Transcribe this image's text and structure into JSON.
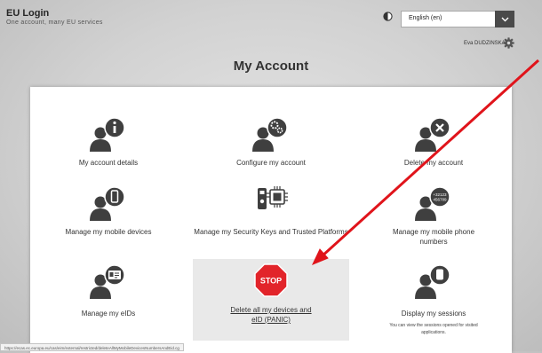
{
  "header": {
    "title": "EU Login",
    "subtitle": "One account, many EU services"
  },
  "language": {
    "selected": "English (en)"
  },
  "user": {
    "name": "Eva DUDZINSKA"
  },
  "page": {
    "title": "My Account"
  },
  "tiles": [
    {
      "label": "My account details",
      "icon": "user-info-icon"
    },
    {
      "label": "Configure my account",
      "icon": "user-gears-icon"
    },
    {
      "label": "Delete my account",
      "icon": "user-delete-icon"
    },
    {
      "label": "Manage my mobile devices",
      "icon": "user-mobile-icon"
    },
    {
      "label": "Manage my Security Keys and Trusted Platforms",
      "icon": "security-key-icon"
    },
    {
      "label": "Manage my mobile phone numbers",
      "icon": "user-phone-number-icon",
      "icon_text_1": "+32123",
      "icon_text_2": "456789"
    },
    {
      "label": "Manage my eIDs",
      "icon": "user-eid-icon"
    },
    {
      "label": "Delete all my devices and eID (PANIC)",
      "icon": "stop-sign-icon",
      "icon_text": "STOP"
    },
    {
      "label": "Display my sessions",
      "icon": "user-sessions-icon",
      "sub": "You can view the sessions opened for visited applications."
    }
  ],
  "status_bar": {
    "url": "https://ecas.ec.europa.eu/cas/eim/external/restricted/deleteAllMyMobileDevicesNumbersAndEid.cg"
  },
  "colors": {
    "icon_dark": "#3f3f3f",
    "arrow_red": "#e0141b",
    "stop_red": "#e2242a",
    "highlight_bg": "#e9e9e9"
  }
}
